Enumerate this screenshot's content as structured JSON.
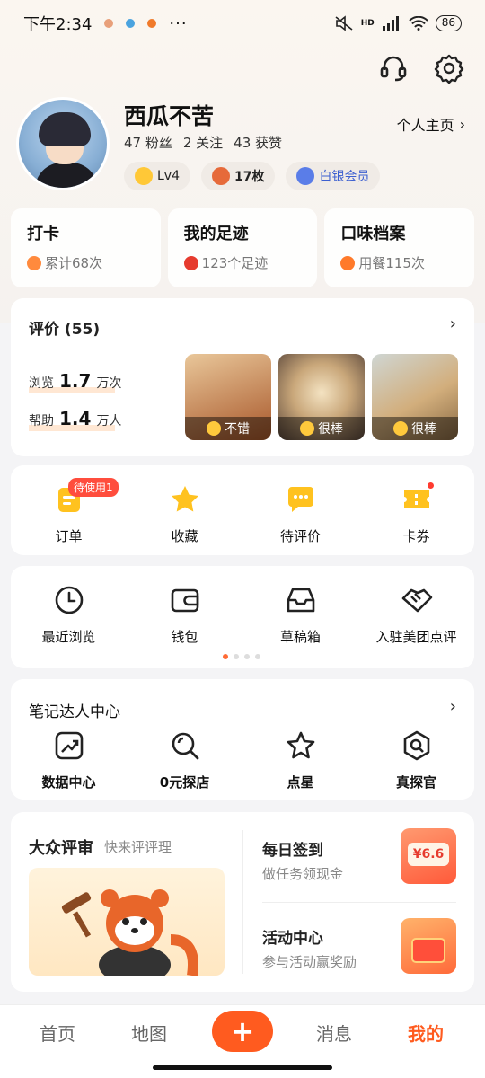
{
  "status_bar": {
    "time": "下午2:34",
    "more": "···",
    "hd": "HD",
    "battery": "86"
  },
  "profile": {
    "name": "西瓜不苦",
    "fans": "47 粉丝",
    "follows": "2 关注",
    "likes": "43 获赞",
    "homepage": "个人主页",
    "badges": [
      {
        "label": "Lv4",
        "color": "#ffc837"
      },
      {
        "label": "17枚",
        "color": "#e66a3a"
      },
      {
        "label": "白银会员",
        "color": "#5a7de8"
      }
    ]
  },
  "quick_cards": [
    {
      "title": "打卡",
      "sub": "累计68次",
      "color": "#ff8a3d"
    },
    {
      "title": "我的足迹",
      "sub": "123个足迹",
      "color": "#e63b2e"
    },
    {
      "title": "口味档案",
      "sub": "用餐115次",
      "color": "#ff7a2a"
    }
  ],
  "reviews": {
    "title": "评价 (55)",
    "views_label": "浏览",
    "views_value": "1.7",
    "views_unit": "万次",
    "helped_label": "帮助",
    "helped_value": "1.4",
    "helped_unit": "万人",
    "photos": [
      {
        "label": "不错",
        "color": "#c9894c"
      },
      {
        "label": "很棒",
        "color": "#b9a58a"
      },
      {
        "label": "很棒",
        "color": "#c7a778"
      }
    ]
  },
  "orders": [
    {
      "label": "订单",
      "badge": "待使用1",
      "icon": "order-icon"
    },
    {
      "label": "收藏",
      "icon": "star-icon"
    },
    {
      "label": "待评价",
      "icon": "comment-icon"
    },
    {
      "label": "卡券",
      "icon": "ticket-icon"
    }
  ],
  "tools": [
    {
      "label": "最近浏览",
      "icon": "clock-icon"
    },
    {
      "label": "钱包",
      "icon": "wallet-icon"
    },
    {
      "label": "草稿箱",
      "icon": "inbox-icon"
    },
    {
      "label": "入驻美团点评",
      "icon": "handshake-icon"
    }
  ],
  "notes_center": {
    "title": "笔记达人中心",
    "items": [
      {
        "label": "数据中心",
        "icon": "chart-icon"
      },
      {
        "label": "0元探店",
        "icon": "search-icon"
      },
      {
        "label": "点星",
        "icon": "star-outline-icon"
      },
      {
        "label": "真探官",
        "icon": "detective-icon"
      }
    ]
  },
  "dazhong": {
    "title": "大众评审",
    "sub": "快来评评理",
    "checkin_title": "每日签到",
    "checkin_sub": "做任务领现金",
    "checkin_amount": "¥6.6",
    "activity_title": "活动中心",
    "activity_sub": "参与活动赢奖励"
  },
  "tabbar": {
    "home": "首页",
    "map": "地图",
    "plus": "+",
    "messages": "消息",
    "mine": "我的"
  }
}
